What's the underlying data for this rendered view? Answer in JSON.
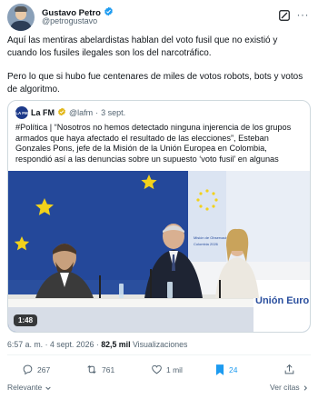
{
  "author": {
    "name": "Gustavo Petro",
    "handle": "@petrogustavo",
    "verified_color": "#1d9bf0"
  },
  "tweet": {
    "paragraphs": [
      "Aquí las mentiras  abelardistas hablan del voto fusil que no existió y cuando los fusiles ilegales son los del narcotráfico.",
      "Pero lo que si hubo fue centenares de miles de votos robots, bots y votos de algoritmo."
    ]
  },
  "quote": {
    "avatar_text": "LA FM",
    "name": "La FM",
    "handle": "@lafm",
    "separator": "·",
    "date": "3 sept.",
    "text": "#Política | “Nosotros no hemos detectado ninguna injerencia de los grupos armados que haya afectado el resultado de las elecciones”, Esteban Gonzales Pons, jefe de la Misión de la Unión Europea en Colombia, respondió así a las denuncias sobre un supuesto ‘voto fusil’ en algunas",
    "video": {
      "duration": "1:48",
      "banner_line1": "Unión Europea",
      "banner_line2": "Misión de Observación Electoral",
      "banner_line3": "Colombia 2026"
    }
  },
  "stats": {
    "time": "6:57 a. m.",
    "separator": "·",
    "date": "4 sept. 2026",
    "views": "82,5 mil",
    "views_label": "Visualizaciones"
  },
  "actions": {
    "replies": "267",
    "reposts": "761",
    "likes": "1 mil",
    "bookmarks": "24",
    "accent": "#1d9bf0"
  },
  "footer": {
    "sort": "Relevante",
    "quotes_link": "Ver citas"
  }
}
